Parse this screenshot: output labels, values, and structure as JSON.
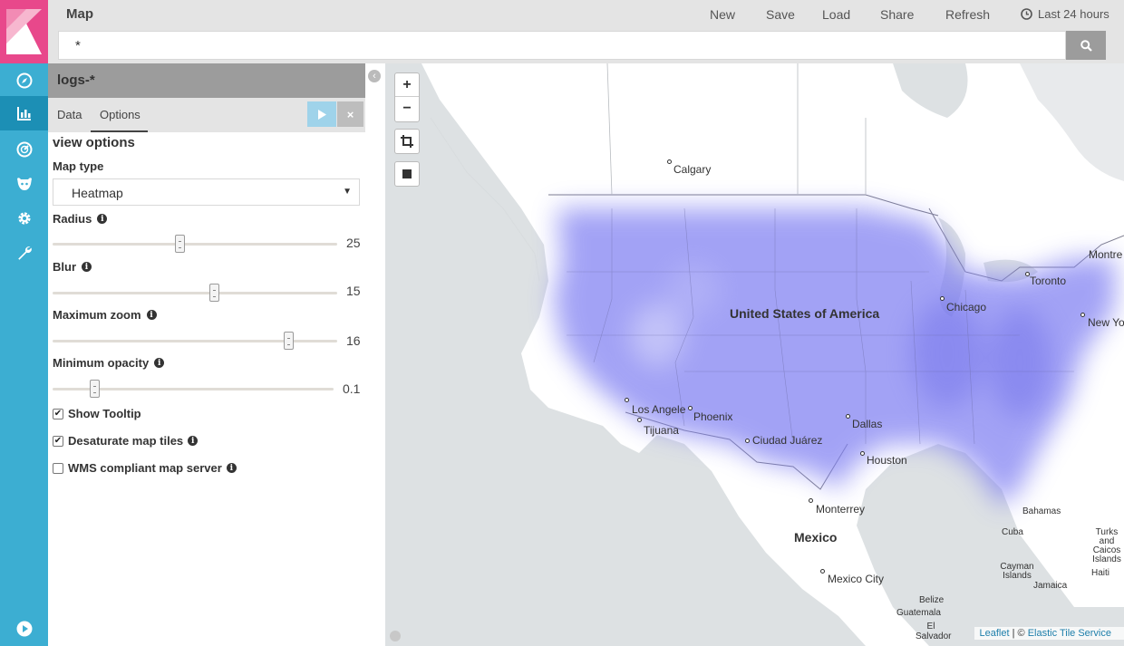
{
  "app": {
    "title": "Map"
  },
  "menu": {
    "new_label": "New",
    "save_label": "Save",
    "load_label": "Load",
    "share_label": "Share",
    "refresh_label": "Refresh",
    "time_label": "Last 24 hours"
  },
  "search": {
    "query": "*"
  },
  "nav": {
    "items": [
      "compass-icon",
      "bar-chart-icon",
      "dashboard-icon",
      "timelion-icon",
      "gear-icon",
      "wrench-icon"
    ],
    "active_item": "bar-chart-icon",
    "accent_color": "#3caed2",
    "logo_color": "#e8488b"
  },
  "sidebar": {
    "index_pattern": "logs-*",
    "tabs": [
      {
        "label": "Data"
      },
      {
        "label": "Options"
      }
    ],
    "active_tab": "Options",
    "discard_label": "×",
    "section_title": "view options",
    "map_type_label": "Map type",
    "map_type_value": "Heatmap",
    "sliders": {
      "radius": {
        "label": "Radius",
        "value": "25",
        "fraction": 0.45
      },
      "blur": {
        "label": "Blur",
        "value": "15",
        "fraction": 0.57
      },
      "max_zoom": {
        "label": "Maximum zoom",
        "value": "16",
        "fraction": 0.83
      },
      "min_opacity": {
        "label": "Minimum opacity",
        "value": "0.1",
        "fraction": 0.15
      }
    },
    "checkboxes": {
      "show_tooltip": {
        "label": "Show Tooltip",
        "checked": true
      },
      "desaturate": {
        "label": "Desaturate map tiles",
        "checked": true
      },
      "wms": {
        "label": "WMS compliant map server",
        "checked": false
      }
    }
  },
  "map": {
    "zoom_in_label": "+",
    "zoom_out_label": "−",
    "heat_color": "#7f7ff2",
    "country_labels": {
      "usa": "United States of America",
      "mexico": "Mexico"
    },
    "city_labels": {
      "calgary": "Calgary",
      "chicago": "Chicago",
      "toronto": "Toronto",
      "montreal": "Montre",
      "new_york": "New Yo",
      "los_angeles": "Los Angele",
      "tijuana": "Tijuana",
      "phoenix": "Phoenix",
      "dallas": "Dallas",
      "houston": "Houston",
      "ciudad_juarez": "Ciudad Juárez",
      "monterrey": "Monterrey",
      "mexico_city": "Mexico City"
    },
    "region_labels": {
      "bahamas": "Bahamas",
      "cuba": "Cuba",
      "turks_caicos": "Turks and Caicos Islands",
      "cayman": "Cayman Islands",
      "haiti": "Haiti",
      "jamaica": "Jamaica",
      "belize": "Belize",
      "guatemala": "Guatemala",
      "el_salvador": "El Salvador"
    },
    "attribution": {
      "leaflet": "Leaflet",
      "separator": " | © ",
      "tiles": "Elastic Tile Service"
    }
  }
}
